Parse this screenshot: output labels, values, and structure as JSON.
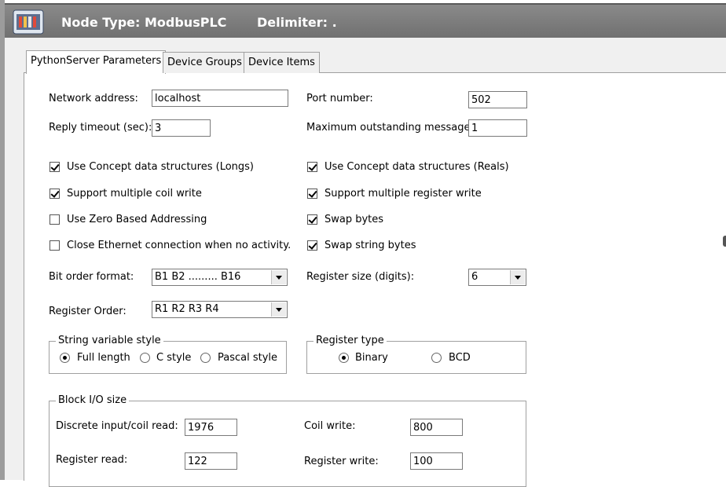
{
  "header": {
    "node_type": "Node Type: ModbusPLC",
    "delimiter": "Delimiter:  ."
  },
  "tabs": [
    {
      "label": "PythonServer Parameters",
      "active": true
    },
    {
      "label": "Device Groups",
      "active": false
    },
    {
      "label": "Device Items",
      "active": false
    }
  ],
  "fields": {
    "network_address": {
      "label": "Network address:",
      "value": "localhost"
    },
    "port_number": {
      "label": "Port number:",
      "value": "502"
    },
    "reply_timeout": {
      "label": "Reply timeout (sec):",
      "value": "3"
    },
    "max_outstanding": {
      "label": "Maximum outstanding messages:",
      "value": "1"
    }
  },
  "checkboxes": {
    "concept_longs": {
      "label": "Use Concept data structures (Longs)",
      "checked": true
    },
    "concept_reals": {
      "label": "Use Concept data structures (Reals)",
      "checked": true
    },
    "multi_coil": {
      "label": "Support multiple coil write",
      "checked": true
    },
    "multi_register": {
      "label": "Support multiple register write",
      "checked": true
    },
    "zero_based": {
      "label": "Use Zero Based Addressing",
      "checked": false
    },
    "swap_bytes": {
      "label": "Swap bytes",
      "checked": true
    },
    "close_ethernet": {
      "label": "Close Ethernet connection when no activity.",
      "checked": false
    },
    "swap_string_bytes": {
      "label": "Swap string bytes",
      "checked": true
    }
  },
  "dropdowns": {
    "bit_order": {
      "label": "Bit order format:",
      "value": "B1  B2  .........  B16"
    },
    "register_size": {
      "label": "Register size (digits):",
      "value": "6"
    },
    "register_order": {
      "label": "Register Order:",
      "value": "R1 R2 R3 R4"
    }
  },
  "string_style": {
    "legend": "String variable style",
    "options": [
      {
        "label": "Full length",
        "selected": true
      },
      {
        "label": "C style",
        "selected": false
      },
      {
        "label": "Pascal style",
        "selected": false
      }
    ]
  },
  "register_type": {
    "legend": "Register type",
    "options": [
      {
        "label": "Binary",
        "selected": true
      },
      {
        "label": "BCD",
        "selected": false
      }
    ]
  },
  "block_io": {
    "legend": "Block I/O size",
    "discrete_read": {
      "label": "Discrete input/coil read:",
      "value": "1976"
    },
    "coil_write": {
      "label": "Coil write:",
      "value": "800"
    },
    "register_read": {
      "label": "Register read:",
      "value": "122"
    },
    "register_write": {
      "label": "Register write:",
      "value": "100"
    }
  }
}
